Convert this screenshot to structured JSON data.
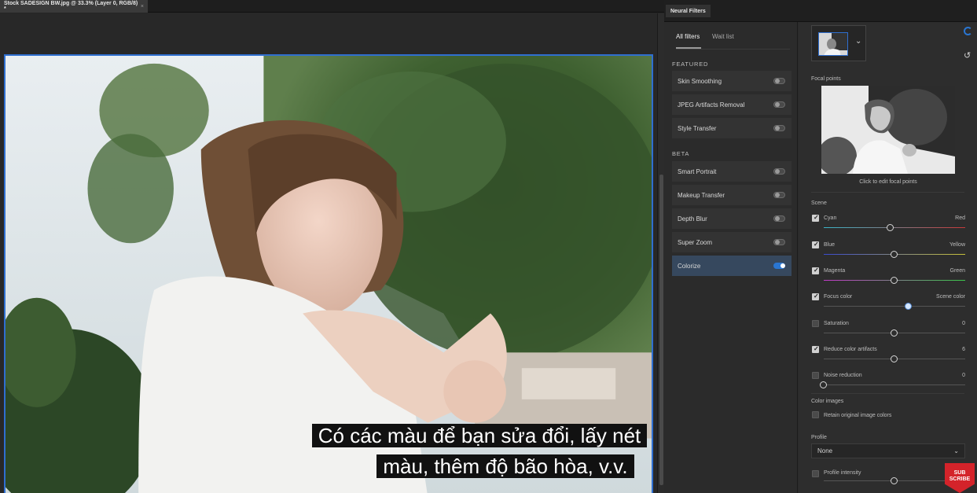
{
  "document": {
    "tab_title": "Stock SADESIGN BW.jpg @ 33.3% (Layer 0, RGB/8) *",
    "close_glyph": "×"
  },
  "subtitle": {
    "line1": "Có các màu để bạn sửa đổi, lấy nét",
    "line2": "màu, thêm độ bão hòa, v.v."
  },
  "panel": {
    "title": "Neural Filters",
    "tabs": [
      {
        "label": "All filters",
        "active": true
      },
      {
        "label": "Wait list",
        "active": false
      }
    ],
    "sections": [
      {
        "label": "FEATURED",
        "filters": [
          {
            "label": "Skin Smoothing",
            "on": false
          },
          {
            "label": "JPEG Artifacts Removal",
            "on": false
          },
          {
            "label": "Style Transfer",
            "on": false
          }
        ]
      },
      {
        "label": "BETA",
        "filters": [
          {
            "label": "Smart Portrait",
            "on": false
          },
          {
            "label": "Makeup Transfer",
            "on": false
          },
          {
            "label": "Depth Blur",
            "on": false
          },
          {
            "label": "Super Zoom",
            "on": false
          },
          {
            "label": "Colorize",
            "on": true
          }
        ]
      }
    ]
  },
  "settings": {
    "focal_points_label": "Focal points",
    "focal_caption": "Click to edit focal points",
    "scene_label": "Scene",
    "sliders": [
      {
        "left": "Cyan",
        "right": "Red",
        "checked": true,
        "value": 0.47,
        "gradient": [
          "#3ab5c9",
          "#c83a3a"
        ]
      },
      {
        "left": "Blue",
        "right": "Yellow",
        "checked": true,
        "value": 0.5,
        "gradient": [
          "#3a4bd0",
          "#c8c23a"
        ]
      },
      {
        "left": "Magenta",
        "right": "Green",
        "checked": true,
        "value": 0.5,
        "gradient": [
          "#c23ac8",
          "#3ac84a"
        ]
      },
      {
        "left": "Focus color",
        "right": "Scene color",
        "checked": true,
        "value": 0.6,
        "gradient": [
          "#555555",
          "#555555"
        ]
      },
      {
        "left": "Saturation",
        "right": "0",
        "checked": false,
        "value": 0.5,
        "gradient": [
          "#555555",
          "#555555"
        ]
      },
      {
        "left": "Reduce color artifacts",
        "right": "6",
        "checked": true,
        "value": 0.5,
        "gradient": [
          "#555555",
          "#555555"
        ]
      },
      {
        "left": "Noise reduction",
        "right": "0",
        "checked": false,
        "value": 0.0,
        "gradient": [
          "#555555",
          "#555555"
        ]
      }
    ],
    "color_images_label": "Color images",
    "retain_label": "Retain original image colors",
    "profile_label": "Profile",
    "profile_value": "None",
    "profile_intensity_label": "Profile intensity",
    "profile_intensity_value": 0.5
  },
  "badge": {
    "line1": "SUB",
    "line2": "SCRIBE"
  },
  "colors": {
    "accent": "#2a76d2",
    "selection": "#2f6fd0",
    "panel": "#2b2b2b"
  }
}
